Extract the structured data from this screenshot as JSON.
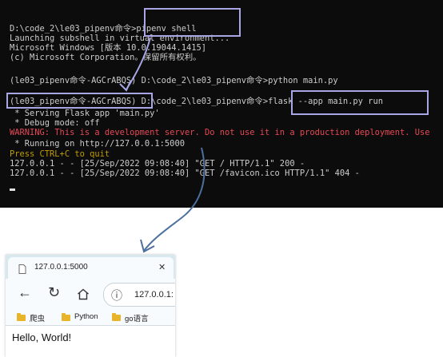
{
  "terminal": {
    "lines": [
      "D:\\code_2\\le03_pipenv命令>pipenv shell",
      "Launching subshell in virtual environment...",
      "Microsoft Windows [版本 10.0.19044.1415]",
      "(c) Microsoft Corporation。保留所有权利。",
      "",
      "(le03_pipenv命令-AGCrABQS) D:\\code_2\\le03_pipenv命令>python main.py",
      "",
      "(le03_pipenv命令-AGCrABQS) D:\\code_2\\le03_pipenv命令>flask --app main.py run",
      " * Serving Flask app 'main.py'",
      " * Debug mode: off",
      "WARNING: This is a development server. Do not use it in a production deployment. Use",
      " * Running on http://127.0.0.1:5000",
      "Press CTRL+C to quit",
      "127.0.0.1 - - [25/Sep/2022 09:08:40] \"GET / HTTP/1.1\" 200 -",
      "127.0.0.1 - - [25/Sep/2022 09:08:40] \"GET /favicon.ico HTTP/1.1\" 404 -"
    ]
  },
  "browser": {
    "tab_title": "127.0.0.1:5000",
    "close_glyph": "✕",
    "back_glyph": "←",
    "reload_glyph": "↻",
    "info_glyph": "ⓘ",
    "url": "127.0.0.1:",
    "bookmarks": [
      "爬虫",
      "Python",
      "go语言"
    ],
    "page_text": "Hello, World!"
  },
  "colors": {
    "terminal_bg": "#0c0c0c",
    "terminal_text": "#cccccc",
    "warning_red": "#e74856",
    "prompt_yellow": "#c19c00",
    "highlight_box": "#a9a6e6",
    "arrow": "#4d6f9e"
  }
}
